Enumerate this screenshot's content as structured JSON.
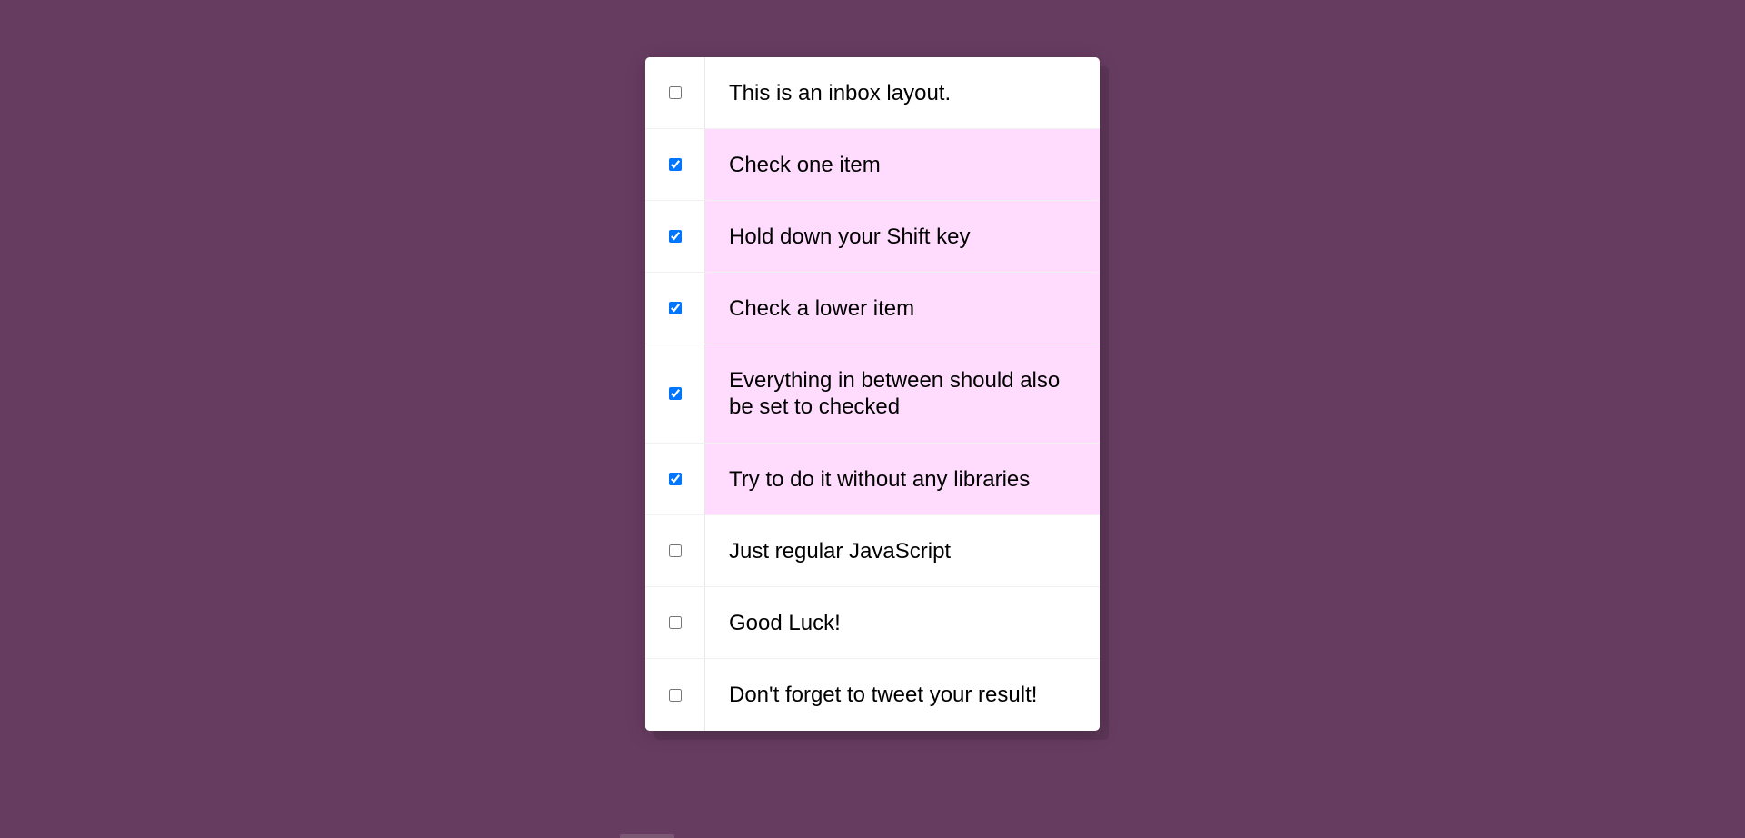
{
  "colors": {
    "background": "#673c61",
    "checked_row": "#ffdcfd",
    "card": "#ffffff",
    "checkbox_accent": "#0075ff"
  },
  "inbox": {
    "items": [
      {
        "label": "This is an inbox layout.",
        "checked": false
      },
      {
        "label": "Check one item",
        "checked": true
      },
      {
        "label": "Hold down your Shift key",
        "checked": true
      },
      {
        "label": "Check a lower item",
        "checked": true
      },
      {
        "label": "Everything in between should also be set to checked",
        "checked": true
      },
      {
        "label": "Try to do it without any libraries",
        "checked": true
      },
      {
        "label": "Just regular JavaScript",
        "checked": false
      },
      {
        "label": "Good Luck!",
        "checked": false
      },
      {
        "label": "Don't forget to tweet your result!",
        "checked": false
      }
    ]
  }
}
